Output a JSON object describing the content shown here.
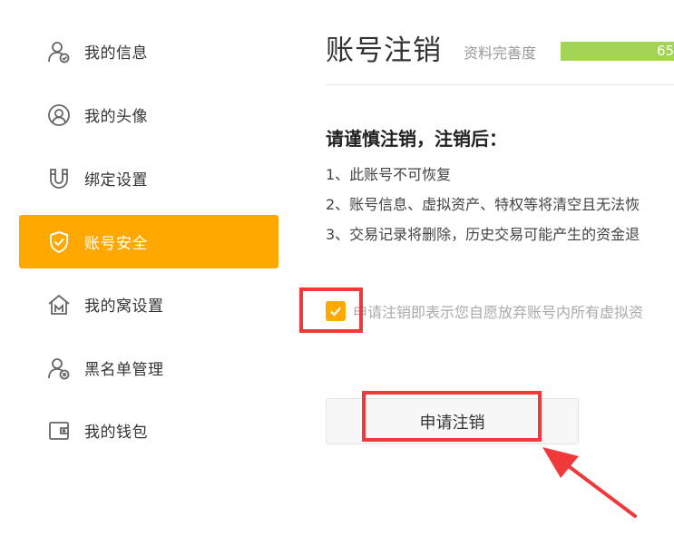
{
  "sidebar": {
    "items": [
      {
        "label": "我的信息",
        "icon": "user-check-icon",
        "active": false
      },
      {
        "label": "我的头像",
        "icon": "avatar-icon",
        "active": false
      },
      {
        "label": "绑定设置",
        "icon": "magnet-icon",
        "active": false
      },
      {
        "label": "账号安全",
        "icon": "shield-check-icon",
        "active": true
      },
      {
        "label": "我的窝设置",
        "icon": "home-icon",
        "active": false
      },
      {
        "label": "黑名单管理",
        "icon": "user-block-icon",
        "active": false
      },
      {
        "label": "我的钱包",
        "icon": "wallet-icon",
        "active": false
      }
    ]
  },
  "header": {
    "title": "账号注销",
    "progress_label": "资料完善度",
    "progress_value": "65"
  },
  "warning": {
    "title": "请谨慎注销，注销后：",
    "items": [
      "1、此账号不可恢复",
      "2、账号信息、虚拟资产、特权等将清空且无法恢",
      "3、交易记录将删除，历史交易可能产生的资金退"
    ]
  },
  "agree": {
    "checked": true,
    "text": "申请注销即表示您自愿放弃账号内所有虚拟资"
  },
  "submit": {
    "label": "申请注销"
  },
  "colors": {
    "accent": "#ffa800",
    "progress": "#a3d455",
    "annotation": "#f0393b"
  }
}
